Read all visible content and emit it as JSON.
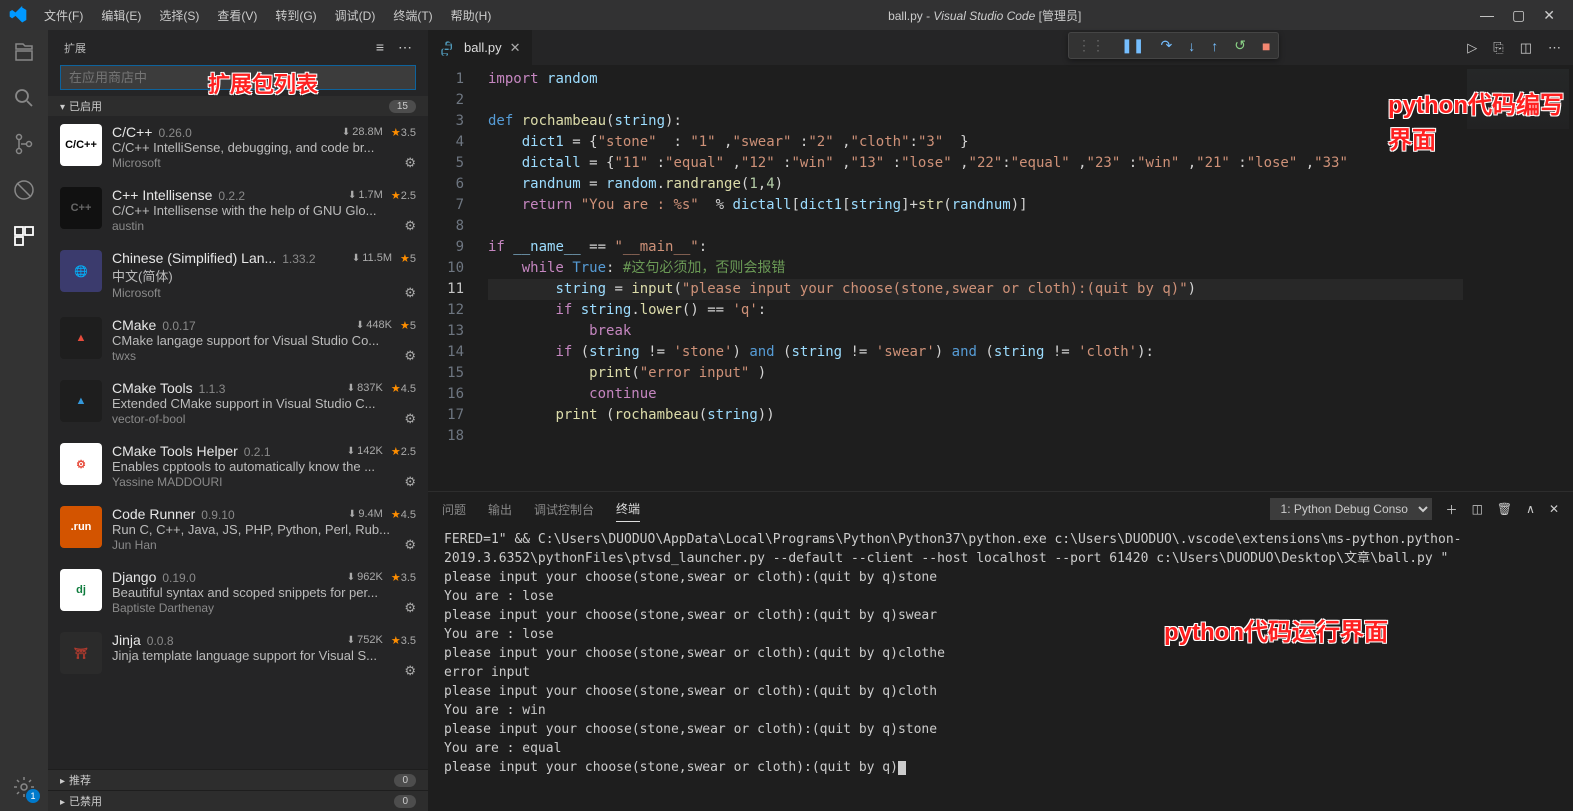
{
  "title": {
    "file": "ball.py",
    "app_italic": "Visual Studio Code",
    "suffix": " [管理员]"
  },
  "menu": [
    "文件(F)",
    "编辑(E)",
    "选择(S)",
    "查看(V)",
    "转到(G)",
    "调试(D)",
    "终端(T)",
    "帮助(H)"
  ],
  "activity_badge": "1",
  "sidebar": {
    "title": "扩展",
    "search_placeholder": "在应用商店中",
    "enabled_label": "已启用",
    "enabled_count": "15",
    "recommended_label": "推荐",
    "recommended_count": "0",
    "disabled_label": "已禁用",
    "disabled_count": "0"
  },
  "annotations": {
    "ext_list": "扩展包列表",
    "editor": "python代码编写界面",
    "terminal": "python代码运行界面"
  },
  "extensions": [
    {
      "name": "C/C++",
      "ver": "0.26.0",
      "dl": "28.8M",
      "rating": "3.5",
      "desc": "C/C++ IntelliSense, debugging, and code br...",
      "pub": "Microsoft",
      "iconbg": "#ffffff",
      "iconfg": "#000",
      "icontxt": "C/C++"
    },
    {
      "name": "C++ Intellisense",
      "ver": "0.2.2",
      "dl": "1.7M",
      "rating": "2.5",
      "desc": "C/C++ Intellisense with the help of GNU Glo...",
      "pub": "austin",
      "iconbg": "#111",
      "iconfg": "#666",
      "icontxt": "C++"
    },
    {
      "name": "Chinese (Simplified) Lan...",
      "ver": "1.33.2",
      "dl": "11.5M",
      "rating": "5",
      "desc": "中文(简体)",
      "pub": "Microsoft",
      "iconbg": "#3b3b6d",
      "iconfg": "#f5d76e",
      "icontxt": "🌐"
    },
    {
      "name": "CMake",
      "ver": "0.0.17",
      "dl": "448K",
      "rating": "5",
      "desc": "CMake langage support for Visual Studio Co...",
      "pub": "twxs",
      "iconbg": "#1e1e1e",
      "iconfg": "#e74c3c",
      "icontxt": "▲"
    },
    {
      "name": "CMake Tools",
      "ver": "1.1.3",
      "dl": "837K",
      "rating": "4.5",
      "desc": "Extended CMake support in Visual Studio C...",
      "pub": "vector-of-bool",
      "iconbg": "#1e1e1e",
      "iconfg": "#3498db",
      "icontxt": "▲"
    },
    {
      "name": "CMake Tools Helper",
      "ver": "0.2.1",
      "dl": "142K",
      "rating": "2.5",
      "desc": "Enables cpptools to automatically know the ...",
      "pub": "Yassine MADDOURI",
      "iconbg": "#fff",
      "iconfg": "#e74c3c",
      "icontxt": "⚙"
    },
    {
      "name": "Code Runner",
      "ver": "0.9.10",
      "dl": "9.4M",
      "rating": "4.5",
      "desc": "Run C, C++, Java, JS, PHP, Python, Perl, Rub...",
      "pub": "Jun Han",
      "iconbg": "#d35400",
      "iconfg": "#fff",
      "icontxt": ".run"
    },
    {
      "name": "Django",
      "ver": "0.19.0",
      "dl": "962K",
      "rating": "3.5",
      "desc": "Beautiful syntax and scoped snippets for per...",
      "pub": "Baptiste Darthenay",
      "iconbg": "#fff",
      "iconfg": "#0f7d3e",
      "icontxt": "dj"
    },
    {
      "name": "Jinja",
      "ver": "0.0.8",
      "dl": "752K",
      "rating": "3.5",
      "desc": "Jinja template language support for Visual S...",
      "pub": "",
      "iconbg": "#2b2b2b",
      "iconfg": "#b03a2e",
      "icontxt": "⛩"
    }
  ],
  "tab": {
    "filename": "ball.py"
  },
  "debug_icons": {
    "grip": "⋮⋮",
    "pause": "❚❚",
    "over": "↷",
    "into": "↓",
    "out": "↑",
    "restart": "↺",
    "stop": "■"
  },
  "code": {
    "lines": [
      [
        {
          "c": "tok-kw",
          "t": "import"
        },
        {
          "t": " "
        },
        {
          "c": "tok-var",
          "t": "random"
        }
      ],
      [],
      [
        {
          "c": "tok-kw2",
          "t": "def"
        },
        {
          "t": " "
        },
        {
          "c": "tok-fn",
          "t": "rochambeau"
        },
        {
          "t": "("
        },
        {
          "c": "tok-var",
          "t": "string"
        },
        {
          "t": "):"
        }
      ],
      [
        {
          "t": "    "
        },
        {
          "c": "tok-var",
          "t": "dict1"
        },
        {
          "t": " = {"
        },
        {
          "c": "tok-str",
          "t": "\"stone\""
        },
        {
          "t": "  : "
        },
        {
          "c": "tok-str",
          "t": "\"1\""
        },
        {
          "t": " ,"
        },
        {
          "c": "tok-str",
          "t": "\"swear\""
        },
        {
          "t": " :"
        },
        {
          "c": "tok-str",
          "t": "\"2\""
        },
        {
          "t": " ,"
        },
        {
          "c": "tok-str",
          "t": "\"cloth\""
        },
        {
          "t": ":"
        },
        {
          "c": "tok-str",
          "t": "\"3\""
        },
        {
          "t": "  }"
        }
      ],
      [
        {
          "t": "    "
        },
        {
          "c": "tok-var",
          "t": "dictall"
        },
        {
          "t": " = {"
        },
        {
          "c": "tok-str",
          "t": "\"11\""
        },
        {
          "t": " :"
        },
        {
          "c": "tok-str",
          "t": "\"equal\""
        },
        {
          "t": " ,"
        },
        {
          "c": "tok-str",
          "t": "\"12\""
        },
        {
          "t": " :"
        },
        {
          "c": "tok-str",
          "t": "\"win\""
        },
        {
          "t": " ,"
        },
        {
          "c": "tok-str",
          "t": "\"13\""
        },
        {
          "t": " :"
        },
        {
          "c": "tok-str",
          "t": "\"lose\""
        },
        {
          "t": " ,"
        },
        {
          "c": "tok-str",
          "t": "\"22\""
        },
        {
          "t": ":"
        },
        {
          "c": "tok-str",
          "t": "\"equal\""
        },
        {
          "t": " ,"
        },
        {
          "c": "tok-str",
          "t": "\"23\""
        },
        {
          "t": " :"
        },
        {
          "c": "tok-str",
          "t": "\"win\""
        },
        {
          "t": " ,"
        },
        {
          "c": "tok-str",
          "t": "\"21\""
        },
        {
          "t": " :"
        },
        {
          "c": "tok-str",
          "t": "\"lose\""
        },
        {
          "t": " ,"
        },
        {
          "c": "tok-str",
          "t": "\"33\""
        }
      ],
      [
        {
          "t": "    "
        },
        {
          "c": "tok-var",
          "t": "randnum"
        },
        {
          "t": " = "
        },
        {
          "c": "tok-var",
          "t": "random"
        },
        {
          "t": "."
        },
        {
          "c": "tok-fn",
          "t": "randrange"
        },
        {
          "t": "("
        },
        {
          "c": "tok-num",
          "t": "1"
        },
        {
          "t": ","
        },
        {
          "c": "tok-num",
          "t": "4"
        },
        {
          "t": ")"
        }
      ],
      [
        {
          "t": "    "
        },
        {
          "c": "tok-kw",
          "t": "return"
        },
        {
          "t": " "
        },
        {
          "c": "tok-str",
          "t": "\"You are : %s\""
        },
        {
          "t": "  % "
        },
        {
          "c": "tok-var",
          "t": "dictall"
        },
        {
          "t": "["
        },
        {
          "c": "tok-var",
          "t": "dict1"
        },
        {
          "t": "["
        },
        {
          "c": "tok-var",
          "t": "string"
        },
        {
          "t": "]+"
        },
        {
          "c": "tok-fn",
          "t": "str"
        },
        {
          "t": "("
        },
        {
          "c": "tok-var",
          "t": "randnum"
        },
        {
          "t": ")]"
        }
      ],
      [],
      [
        {
          "c": "tok-kw",
          "t": "if"
        },
        {
          "t": " "
        },
        {
          "c": "tok-var",
          "t": "__name__"
        },
        {
          "t": " == "
        },
        {
          "c": "tok-str",
          "t": "\"__main__\""
        },
        {
          "t": ":"
        }
      ],
      [
        {
          "t": "    "
        },
        {
          "c": "tok-kw",
          "t": "while"
        },
        {
          "t": " "
        },
        {
          "c": "tok-kw2",
          "t": "True"
        },
        {
          "t": ": "
        },
        {
          "c": "tok-cmt",
          "t": "#这句必须加，否则会报错"
        }
      ],
      [
        {
          "t": "        "
        },
        {
          "c": "tok-var",
          "t": "string"
        },
        {
          "t": " = "
        },
        {
          "c": "tok-fn",
          "t": "input"
        },
        {
          "t": "("
        },
        {
          "c": "tok-str",
          "t": "\"please input your choose(stone,swear or cloth):(quit by q)\""
        },
        {
          "t": ")"
        }
      ],
      [
        {
          "t": "        "
        },
        {
          "c": "tok-kw",
          "t": "if"
        },
        {
          "t": " "
        },
        {
          "c": "tok-var",
          "t": "string"
        },
        {
          "t": "."
        },
        {
          "c": "tok-fn",
          "t": "lower"
        },
        {
          "t": "() == "
        },
        {
          "c": "tok-str",
          "t": "'q'"
        },
        {
          "t": ":"
        }
      ],
      [
        {
          "t": "            "
        },
        {
          "c": "tok-kw",
          "t": "break"
        }
      ],
      [
        {
          "t": "        "
        },
        {
          "c": "tok-kw",
          "t": "if"
        },
        {
          "t": " ("
        },
        {
          "c": "tok-var",
          "t": "string"
        },
        {
          "t": " != "
        },
        {
          "c": "tok-str",
          "t": "'stone'"
        },
        {
          "t": ") "
        },
        {
          "c": "tok-kw2",
          "t": "and"
        },
        {
          "t": " ("
        },
        {
          "c": "tok-var",
          "t": "string"
        },
        {
          "t": " != "
        },
        {
          "c": "tok-str",
          "t": "'swear'"
        },
        {
          "t": ") "
        },
        {
          "c": "tok-kw2",
          "t": "and"
        },
        {
          "t": " ("
        },
        {
          "c": "tok-var",
          "t": "string"
        },
        {
          "t": " != "
        },
        {
          "c": "tok-str",
          "t": "'cloth'"
        },
        {
          "t": "):"
        }
      ],
      [
        {
          "t": "            "
        },
        {
          "c": "tok-fn",
          "t": "print"
        },
        {
          "t": "("
        },
        {
          "c": "tok-str",
          "t": "\"error input\""
        },
        {
          "t": " )"
        }
      ],
      [
        {
          "t": "            "
        },
        {
          "c": "tok-kw",
          "t": "continue"
        }
      ],
      [
        {
          "t": "        "
        },
        {
          "c": "tok-fn",
          "t": "print"
        },
        {
          "t": " ("
        },
        {
          "c": "tok-fn",
          "t": "rochambeau"
        },
        {
          "t": "("
        },
        {
          "c": "tok-var",
          "t": "string"
        },
        {
          "t": "))"
        }
      ],
      []
    ],
    "current_line": 11
  },
  "panel": {
    "tabs": [
      "问题",
      "输出",
      "调试控制台",
      "终端"
    ],
    "active_tab": 3,
    "term_name": "1: Python Debug Conso",
    "output": "FERED=1\" && C:\\Users\\DUODUO\\AppData\\Local\\Programs\\Python\\Python37\\python.exe c:\\Users\\DUODUO\\.vscode\\extensions\\ms-python.python-2019.3.6352\\pythonFiles\\ptvsd_launcher.py --default --client --host localhost --port 61420 c:\\Users\\DUODUO\\Desktop\\文章\\ball.py \"\nplease input your choose(stone,swear or cloth):(quit by q)stone\nYou are : lose\nplease input your choose(stone,swear or cloth):(quit by q)swear\nYou are : lose\nplease input your choose(stone,swear or cloth):(quit by q)clothe\nerror input\nplease input your choose(stone,swear or cloth):(quit by q)cloth\nYou are : win\nplease input your choose(stone,swear or cloth):(quit by q)stone\nYou are : equal\nplease input your choose(stone,swear or cloth):(quit by q)"
  }
}
